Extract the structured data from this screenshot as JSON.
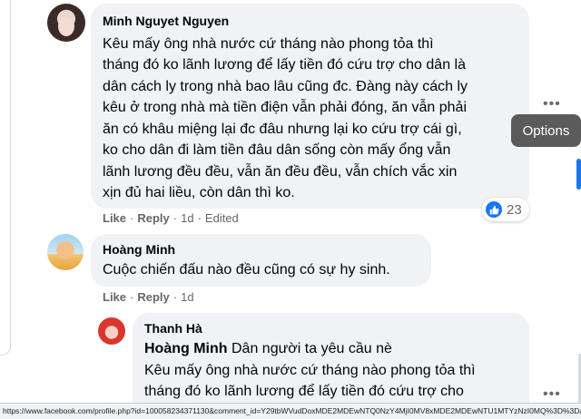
{
  "comments": [
    {
      "author": "Minh Nguyet Nguyen",
      "lines": [
        "Kêu mấy ông nhà nước cứ tháng nào phong tỏa thì",
        "tháng đó ko lãnh lương để lấy tiền đó cứu trợ cho dân là",
        "dân cách ly trong nhà bao lâu cũng đc. Đàng này cách ly",
        "kêu ở trong nhà mà tiền điện vẫn phải đóng, ăn vẫn phải",
        "ăn có khâu miệng lại đc đâu nhưng lại ko cứu trợ cái gì,",
        "ko cho dân đi làm tiền đâu dân sống còn mấy ổng vẫn",
        "lãnh lương đều đều, vẫn ăn đều đều, vẫn chích vắc xin",
        "xịn đủ hai liều, còn dân thì ko."
      ],
      "like_label": "Like",
      "reply_label": "Reply",
      "time": "1d",
      "edited_label": "Edited",
      "reaction_count": "23"
    },
    {
      "author": "Hoàng Minh",
      "lines": [
        "Cuộc chiến đấu nào đều cũng có sự hy sinh."
      ],
      "like_label": "Like",
      "reply_label": "Reply",
      "time": "1d"
    },
    {
      "author": "Thanh Hà",
      "mention": "Hoàng Minh",
      "first_line_rest": " Dân người ta yêu cầu nè",
      "lines": [
        "Kêu mấy ông nhà nước cứ tháng nào phong tỏa thì",
        "tháng đó ko lãnh lương để lấy tiền đó cứu trợ cho"
      ]
    }
  ],
  "tooltip": "Options",
  "more_glyph": "•••",
  "dot": "·",
  "status_url": "https://www.facebook.com/profile.php?id=100058234371130&comment_id=Y29tbWVudDoxMDE2MDEwNTQ0NzY4MjI0MV8xMDE2MDEwNTU1MTYzNzI0MQ%3D%3D&__cft__[0]=AZWRmfL7_77GNzflPPJDRVwsCGW",
  "colors": {
    "bubble": "#f0f2f5",
    "meta": "#65676b",
    "accent": "#1877f2"
  }
}
